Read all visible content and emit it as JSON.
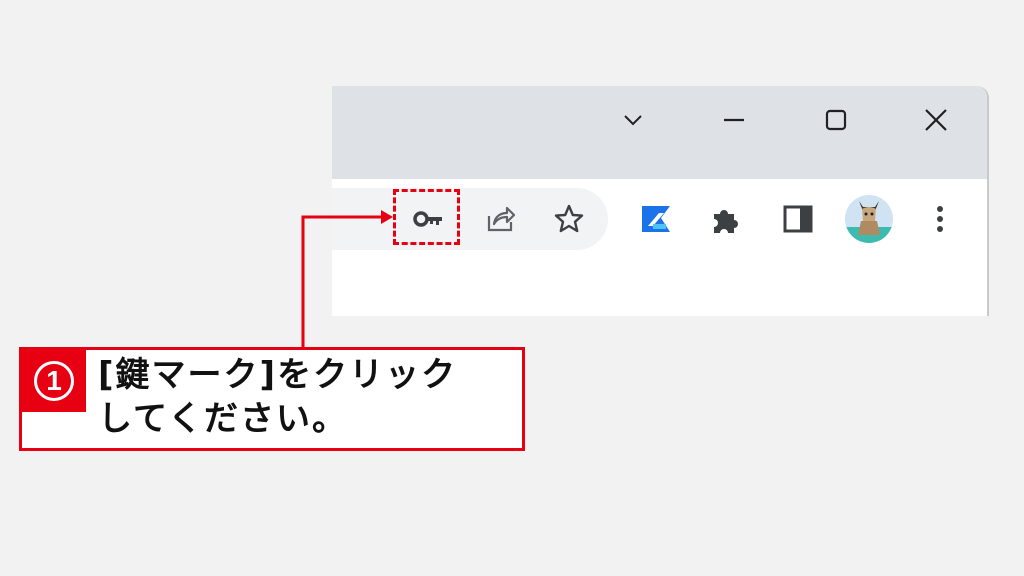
{
  "window_controls": {
    "items": [
      {
        "name": "tab-search-chevron-icon"
      },
      {
        "name": "minimize-icon"
      },
      {
        "name": "maximize-icon"
      },
      {
        "name": "close-icon"
      }
    ]
  },
  "toolbar": {
    "omnibox_icons": [
      "key-icon",
      "share-icon",
      "star-icon"
    ],
    "extension_icons": [
      "extension-logo-icon",
      "puzzle-extensions-icon",
      "side-panel-icon",
      "profile-avatar",
      "more-menu-icon"
    ]
  },
  "colors": {
    "accent_red": "#e60012",
    "titlebar": "#dee1e6",
    "omnibox": "#f1f3f4",
    "icon": "#3c4043"
  },
  "callout": {
    "number": "①",
    "line1": "[鍵マーク]をクリック",
    "line2": "してください。"
  }
}
